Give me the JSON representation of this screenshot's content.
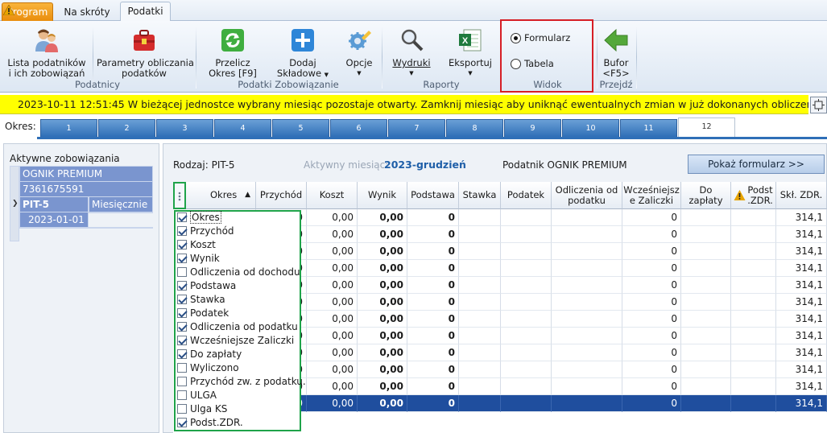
{
  "ribbon_tabs": {
    "program": "Program",
    "na_skroty": "Na skróty",
    "podatki": "Podatki"
  },
  "ribbon": {
    "lista_line1": "Lista podatników",
    "lista_line2": "i ich zobowiązań",
    "param_line1": "Parametry obliczania",
    "param_line2": "podatków",
    "group_podatnicy": "Podatnicy",
    "przelicz_line1": "Przelicz",
    "przelicz_line2": "Okres [F9]",
    "dodaj_line1": "Dodaj",
    "dodaj_line2": "Składowe",
    "opcje": "Opcje",
    "group_zobowiazanie": "Podatki Zobowiązanie",
    "wydruki": "Wydruki",
    "eksportuj": "Eksportuj",
    "group_raporty": "Raporty",
    "radio_formularz": "Formularz",
    "radio_tabela": "Tabela",
    "selected_view": "Formularz",
    "group_widok": "Widok",
    "bufor_line1": "Bufor",
    "bufor_line2": "<F5>",
    "group_przejdz": "Przejdź"
  },
  "warning": {
    "text": "2023-10-11 12:51:45  W bieżącej jednostce wybrany miesiąc pozostaje otwarty. Zamknij miesiąc aby uniknąć ewentualnych zmian w już dokonanych obliczeniach."
  },
  "okres": {
    "label": "Okres:",
    "tabs": [
      "1",
      "2",
      "3",
      "4",
      "5",
      "6",
      "7",
      "8",
      "9",
      "10",
      "11",
      "12"
    ],
    "active": "12"
  },
  "left_panel": {
    "title": "Aktywne zobowiązania",
    "name": "OGNIK PREMIUM",
    "nip": "7361675591",
    "pit": "PIT-5",
    "frequency": "Miesięcznie",
    "date": "2023-01-01"
  },
  "header": {
    "rodzaj": "Rodzaj: PIT-5",
    "aktywny_label": "Aktywny miesiąc:",
    "aktywny_value": "2023-grudzień",
    "podatnik": "Podatnik OGNIK PREMIUM",
    "pokaz_button": "Pokaż formularz >>"
  },
  "columns": {
    "okres": "Okres",
    "przychod": "Przychód",
    "koszt": "Koszt",
    "wynik": "Wynik",
    "podstawa": "Podstawa",
    "stawka": "Stawka",
    "podatek": "Podatek",
    "odliczenia_1": "Odliczenia od",
    "odliczenia_2": "podatku",
    "wczesniejsze_1": "Wcześniejsz",
    "wczesniejsze_2": "e Zaliczki",
    "do_zaplaty": "Do zapłaty",
    "podst_zdr_1": "Podst",
    "podst_zdr_2": ".ZDR.",
    "skl_zdr": "Skł. ZDR."
  },
  "rows": [
    {
      "przychod": "00",
      "koszt": "0,00",
      "wynik": "0,00",
      "podstawa": "0",
      "zaliczki": "0",
      "skl": "314,1"
    },
    {
      "przychod": "00",
      "koszt": "0,00",
      "wynik": "0,00",
      "podstawa": "0",
      "zaliczki": "0",
      "skl": "314,1"
    },
    {
      "przychod": "00",
      "koszt": "0,00",
      "wynik": "0,00",
      "podstawa": "0",
      "zaliczki": "0",
      "skl": "314,1"
    },
    {
      "przychod": "00",
      "koszt": "0,00",
      "wynik": "0,00",
      "podstawa": "0",
      "zaliczki": "0",
      "skl": "314,1"
    },
    {
      "przychod": "00",
      "koszt": "0,00",
      "wynik": "0,00",
      "podstawa": "0",
      "zaliczki": "0",
      "skl": "314,1"
    },
    {
      "przychod": "00",
      "koszt": "0,00",
      "wynik": "0,00",
      "podstawa": "0",
      "zaliczki": "0",
      "skl": "314,1"
    },
    {
      "przychod": "00",
      "koszt": "0,00",
      "wynik": "0,00",
      "podstawa": "0",
      "zaliczki": "0",
      "skl": "314,1"
    },
    {
      "przychod": "00",
      "koszt": "0,00",
      "wynik": "0,00",
      "podstawa": "0",
      "zaliczki": "0",
      "skl": "314,1"
    },
    {
      "przychod": "00",
      "koszt": "0,00",
      "wynik": "0,00",
      "podstawa": "0",
      "zaliczki": "0",
      "skl": "314,1"
    },
    {
      "przychod": "00",
      "koszt": "0,00",
      "wynik": "0,00",
      "podstawa": "0",
      "zaliczki": "0",
      "skl": "314,1"
    },
    {
      "przychod": "00",
      "koszt": "0,00",
      "wynik": "0,00",
      "podstawa": "0",
      "zaliczki": "0",
      "skl": "314,1"
    },
    {
      "przychod": "00",
      "koszt": "0,00",
      "wynik": "0,00",
      "podstawa": "0",
      "zaliczki": "0",
      "skl": "314,1"
    }
  ],
  "selected_row_index": 11,
  "column_chooser": [
    {
      "label": "Okres",
      "checked": true
    },
    {
      "label": "Przychód",
      "checked": true
    },
    {
      "label": "Koszt",
      "checked": true
    },
    {
      "label": "Wynik",
      "checked": true
    },
    {
      "label": "Odliczenia od dochodu",
      "checked": false
    },
    {
      "label": "Podstawa",
      "checked": true
    },
    {
      "label": "Stawka",
      "checked": true
    },
    {
      "label": "Podatek",
      "checked": true
    },
    {
      "label": "Odliczenia od podatku",
      "checked": true
    },
    {
      "label": "Wcześniejsze Zaliczki",
      "checked": true
    },
    {
      "label": "Do zapłaty",
      "checked": true
    },
    {
      "label": "Wyliczono",
      "checked": false
    },
    {
      "label": "Przychód zw. z podatku.",
      "checked": false
    },
    {
      "label": "ULGA",
      "checked": false
    },
    {
      "label": "Ulga KS",
      "checked": false
    },
    {
      "label": "Podst.ZDR.",
      "checked": true
    }
  ],
  "colors": {
    "accent": "#2f6fb7",
    "warning_bg": "#ffff00",
    "selection": "#1f4e9e",
    "widok_highlight": "#d61f26",
    "chooser_highlight": "#1fa34a"
  }
}
